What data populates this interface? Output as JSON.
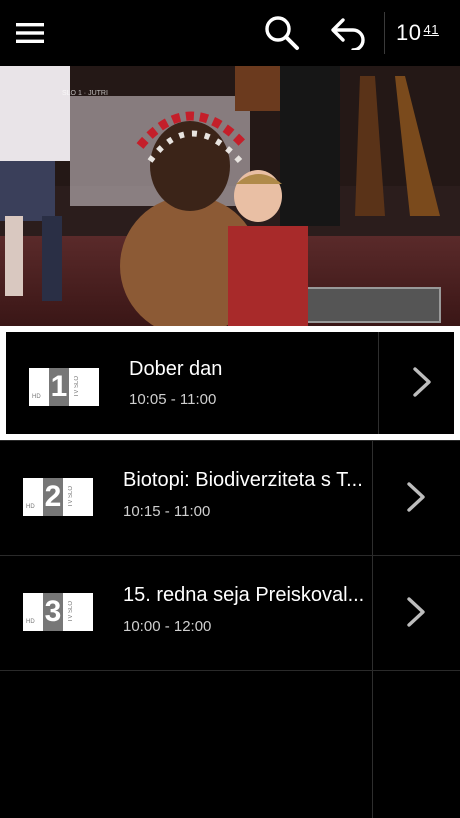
{
  "header": {
    "menu_icon": "hamburger-menu-icon",
    "search_icon": "search-icon",
    "back_icon": "back-arrow-icon",
    "clock_hours": "10",
    "clock_minutes": "41"
  },
  "player": {
    "overlay_text": "SLO 1 · JUTRI"
  },
  "programs": [
    {
      "channel_number": "1",
      "channel_badge": "HD",
      "channel_side": "TV SLO",
      "title": "Dober dan",
      "time": "10:05 - 11:00",
      "selected": true
    },
    {
      "channel_number": "2",
      "channel_badge": "HD",
      "channel_side": "TV SLO",
      "title": "Biotopi: Biodiverziteta s T...",
      "time": "10:15 - 11:00",
      "selected": false
    },
    {
      "channel_number": "3",
      "channel_badge": "HD",
      "channel_side": "TV SLO",
      "title": "15. redna seja Preiskoval...",
      "time": "10:00 - 12:00",
      "selected": false
    }
  ],
  "colors": {
    "background": "#000000",
    "selection_border": "#ffffff",
    "secondary_text": "#cfcfcf"
  }
}
